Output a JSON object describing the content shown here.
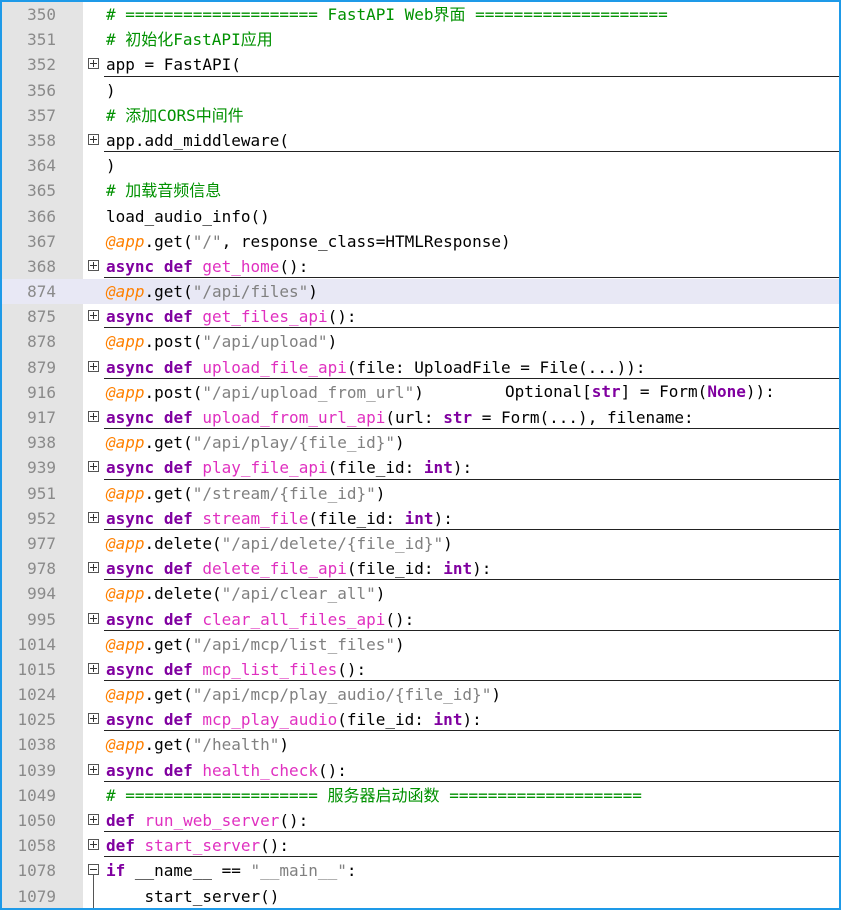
{
  "editor": {
    "language": "python",
    "colors": {
      "comment": "#009100",
      "keyword": "#8000a0",
      "function_name": "#e030c0",
      "decorator": "#ff8000",
      "string": "#808080",
      "border": "#1e9ae8",
      "current_line": "#e8e8f5"
    },
    "lines": [
      {
        "number": "350",
        "text": "# ==================== FastAPI Web界面 ===================="
      },
      {
        "number": "351",
        "text": "# 初始化FastAPI应用"
      },
      {
        "number": "352",
        "text": "app = FastAPI(",
        "fold": "collapsed"
      },
      {
        "number": "356",
        "text": ")"
      },
      {
        "number": "357",
        "text": "# 添加CORS中间件"
      },
      {
        "number": "358",
        "text": "app.add_middleware(",
        "fold": "collapsed"
      },
      {
        "number": "364",
        "text": ")"
      },
      {
        "number": "365",
        "text": "# 加载音频信息"
      },
      {
        "number": "366",
        "text": "load_audio_info()"
      },
      {
        "number": "367",
        "text": "@app.get(\"/\", response_class=HTMLResponse)"
      },
      {
        "number": "368",
        "text": "async def get_home():",
        "fold": "collapsed"
      },
      {
        "number": "874",
        "text": "@app.get(\"/api/files\")",
        "current": true
      },
      {
        "number": "875",
        "text": "async def get_files_api():",
        "fold": "collapsed"
      },
      {
        "number": "878",
        "text": "@app.post(\"/api/upload\")"
      },
      {
        "number": "879",
        "text": "async def upload_file_api(file: UploadFile = File(...)):",
        "fold": "collapsed"
      },
      {
        "number": "916",
        "text": "@app.post(\"/api/upload_from_url\")",
        "overflow": "Optional[str] = Form(None)):"
      },
      {
        "number": "917",
        "text": "async def upload_from_url_api(url: str = Form(...), filename:",
        "fold": "collapsed"
      },
      {
        "number": "938",
        "text": "@app.get(\"/api/play/{file_id}\")"
      },
      {
        "number": "939",
        "text": "async def play_file_api(file_id: int):",
        "fold": "collapsed"
      },
      {
        "number": "951",
        "text": "@app.get(\"/stream/{file_id}\")"
      },
      {
        "number": "952",
        "text": "async def stream_file(file_id: int):",
        "fold": "collapsed"
      },
      {
        "number": "977",
        "text": "@app.delete(\"/api/delete/{file_id}\")"
      },
      {
        "number": "978",
        "text": "async def delete_file_api(file_id: int):",
        "fold": "collapsed"
      },
      {
        "number": "994",
        "text": "@app.delete(\"/api/clear_all\")"
      },
      {
        "number": "995",
        "text": "async def clear_all_files_api():",
        "fold": "collapsed"
      },
      {
        "number": "1014",
        "text": "@app.get(\"/api/mcp/list_files\")"
      },
      {
        "number": "1015",
        "text": "async def mcp_list_files():",
        "fold": "collapsed"
      },
      {
        "number": "1024",
        "text": "@app.get(\"/api/mcp/play_audio/{file_id}\")"
      },
      {
        "number": "1025",
        "text": "async def mcp_play_audio(file_id: int):",
        "fold": "collapsed"
      },
      {
        "number": "1038",
        "text": "@app.get(\"/health\")"
      },
      {
        "number": "1039",
        "text": "async def health_check():",
        "fold": "collapsed"
      },
      {
        "number": "1049",
        "text": "# ==================== 服务器启动函数 ===================="
      },
      {
        "number": "1050",
        "text": "def run_web_server():",
        "fold": "collapsed"
      },
      {
        "number": "1058",
        "text": "def start_server():",
        "fold": "collapsed"
      },
      {
        "number": "1078",
        "text": "if __name__ == \"__main__\":",
        "fold": "expanded"
      },
      {
        "number": "1079",
        "text": "    start_server()"
      }
    ]
  }
}
